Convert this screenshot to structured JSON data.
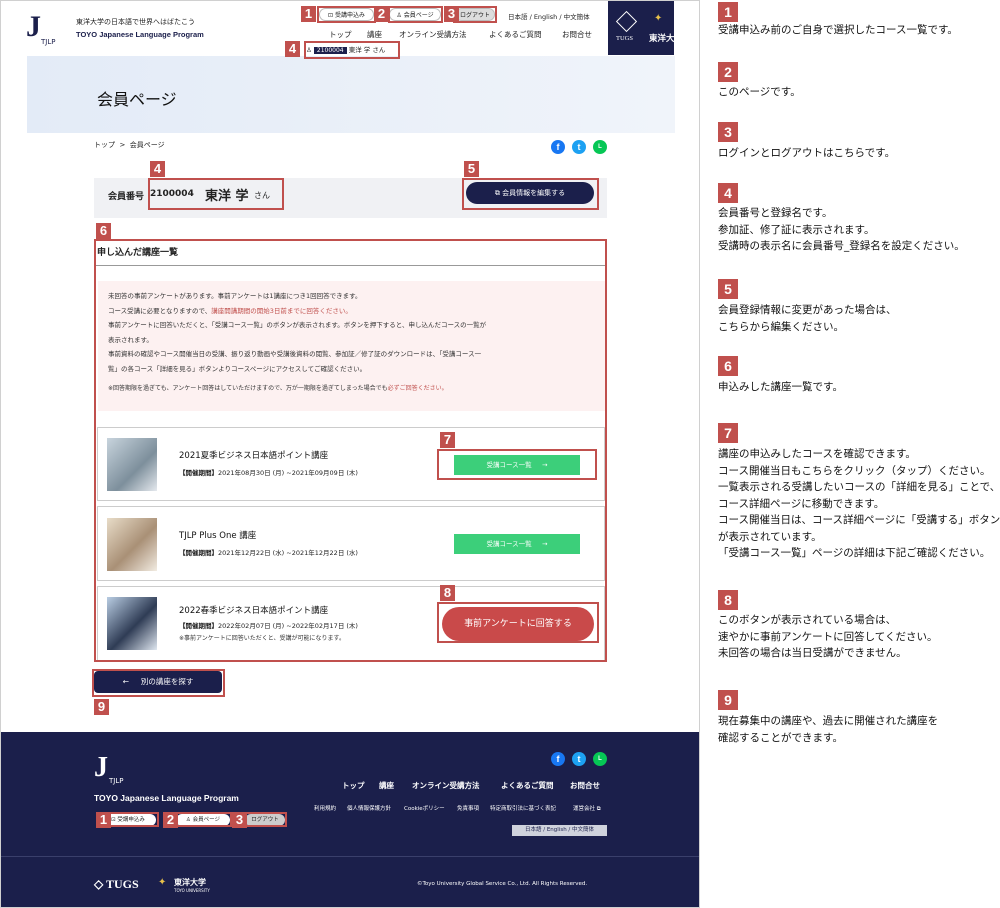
{
  "header": {
    "logo_text": "J",
    "logo_sub": "TJLP",
    "tagline_jp": "東洋大学の日本語で世界へはばたこう",
    "tagline_en": "TOYO Japanese Language Program",
    "btn_apply": "受講申込み",
    "btn_member": "会員ページ",
    "btn_logout": "ログアウト",
    "lang_links": "日本語 / English / 中文簡体",
    "nav": [
      "トップ",
      "講座",
      "オンライン受講方法",
      "よくあるご質問",
      "お問合せ"
    ],
    "tugs": "TUGS",
    "univ": "東洋大学",
    "user_id": "2100004",
    "user_name": "東洋 学 さん"
  },
  "page": {
    "title": "会員ページ",
    "breadcrumb_top": "トップ",
    "breadcrumb_sep": ">",
    "breadcrumb_current": "会員ページ"
  },
  "member": {
    "label": "会員番号",
    "id": "2100004",
    "name": "東洋 学",
    "suffix": "さん",
    "edit_button": "会員情報を編集する"
  },
  "courses": {
    "heading": "申し込んだ講座一覧",
    "notice": [
      {
        "pre": "未回答の事前アンケートがあります。事前アンケートは1講座につき1回回答できます。",
        "red": "",
        "post": ""
      },
      {
        "pre": "コース受講に必要となりますので、",
        "red": "講座開講期間の開始3日前までに回答ください。",
        "post": ""
      },
      {
        "pre": "事前アンケートに回答いただくと、「受講コース一覧」のボタンが表示されます。ボタンを押下すると、申し込んだコースの一覧が",
        "red": "",
        "post": ""
      },
      {
        "pre": "表示されます。",
        "red": "",
        "post": ""
      },
      {
        "pre": "事前資料の確認やコース開催当日の受講、振り返り動画や受講後資料の閲覧、参加証／修了証のダウンロードは、「受講コース一",
        "red": "",
        "post": ""
      },
      {
        "pre": "覧」の各コース「詳細を見る」ボタンよりコースページにアクセスしてご確認ください。",
        "red": "",
        "post": ""
      },
      {
        "pre": "※回答期限を過ぎても、アンケート回答はしていただけますので、万が一期限を過ぎてしまった場合でも",
        "red": "必ずご回答ください。",
        "post": ""
      }
    ],
    "items": [
      {
        "title": "2021夏季ビジネス日本語ポイント講座",
        "period_label": "【開催期間】",
        "period": "2021年08月30日 (月) ~2021年09月09日 (木)",
        "button": "受講コース一覧",
        "note": ""
      },
      {
        "title": "TJLP Plus One 講座",
        "period_label": "【開催期間】",
        "period": "2021年12月22日 (水) ~2021年12月22日 (水)",
        "button": "受講コース一覧",
        "note": ""
      },
      {
        "title": "2022春季ビジネス日本語ポイント講座",
        "period_label": "【開催期間】",
        "period": "2022年02月07日 (月) ~2022年02月17日 (木)",
        "button": "事前アンケートに回答する",
        "note": "※事前アンケートに回答いただくと、受講が可能になります。"
      }
    ],
    "find_button": "別の講座を探す",
    "arrow": "→",
    "back_arrow": "←"
  },
  "footer": {
    "logo_text": "J",
    "logo_sub": "TJLP",
    "name": "TOYO Japanese Language Program",
    "nav": [
      "トップ",
      "講座",
      "オンライン受講方法",
      "よくあるご質問",
      "お問合せ"
    ],
    "links": [
      "利用規約",
      "個人情報保護方針",
      "Cookieポリシー",
      "免責事項",
      "特定商取引法に基づく表記",
      "運営会社"
    ],
    "btn_apply": "受講申込み",
    "btn_member": "会員ページ",
    "btn_logout": "ログアウト",
    "lang_links": "日本語 / English / 中文簡体",
    "tugs": "TUGS",
    "univ": "東洋大学",
    "univ_en": "TOYO UNIVERSITY",
    "copyright": "©Toyo University Global Service Co., Ltd. All Rights Reserved."
  },
  "markers": [
    "1",
    "2",
    "3",
    "4",
    "5",
    "6",
    "7",
    "8",
    "9"
  ],
  "annotations": [
    {
      "num": "1",
      "lines": [
        "受講申込み前のご自身で選択したコース一覧です。"
      ]
    },
    {
      "num": "2",
      "lines": [
        "このページです。"
      ]
    },
    {
      "num": "3",
      "lines": [
        "ログインとログアウトはこちらです。"
      ]
    },
    {
      "num": "4",
      "lines": [
        "会員番号と登録名です。",
        "参加証、修了証に表示されます。",
        "受講時の表示名に会員番号_登録名を設定ください。"
      ]
    },
    {
      "num": "5",
      "lines": [
        "会員登録情報に変更があった場合は、",
        "こちらから編集ください。"
      ]
    },
    {
      "num": "6",
      "lines": [
        "申込みした講座一覧です。"
      ]
    },
    {
      "num": "7",
      "lines": [
        "講座の申込みしたコースを確認できます。",
        "コース開催当日もこちらをクリック（タップ）ください。",
        "一覧表示される受講したいコースの「詳細を見る」ことで、",
        "コース詳細ページに移動できます。",
        "コース開催当日は、コース詳細ページに「受講する」ボタン",
        "が表示されています。",
        "「受講コース一覧」ページの詳細は下記ご確認ください。"
      ]
    },
    {
      "num": "8",
      "lines": [
        "このボタンが表示されている場合は、",
        "速やかに事前アンケートに回答してください。",
        "未回答の場合は当日受講ができません。"
      ]
    },
    {
      "num": "9",
      "lines": [
        "現在募集中の講座や、過去に開催された講座を",
        "確認することができます。"
      ]
    }
  ],
  "colors": {
    "navy": "#1b1f4b",
    "accent_red": "#c0504d",
    "green": "#3ccf7a",
    "survey_red": "#c94a4a"
  }
}
